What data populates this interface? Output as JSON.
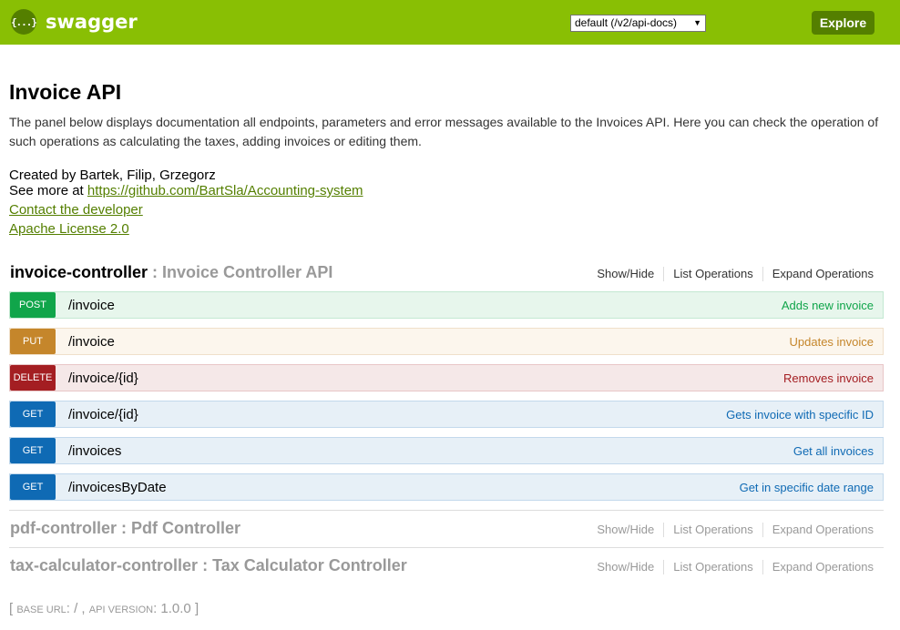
{
  "header": {
    "logo_glyph": "{...}",
    "logo_text": "swagger",
    "spec_select": "default (/v2/api-docs)",
    "explore_label": "Explore",
    "bg_color": "#89bf04"
  },
  "info": {
    "title": "Invoice API",
    "description": "The panel below displays documentation all endpoints, parameters and error messages available to the Invoices API. Here you can check the operation of such operations as calculating the taxes, adding invoices or editing them.",
    "created_by": "Created by Bartek, Filip, Grzegorz",
    "see_more_prefix": "See more at ",
    "see_more_link": "https://github.com/BartSla/Accounting-system",
    "contact_link": "Contact the developer",
    "license_link": "Apache License 2.0"
  },
  "resources": [
    {
      "name": "invoice-controller",
      "separator": " : ",
      "description": "Invoice Controller API",
      "show_hide": "Show/Hide",
      "list_ops": "List Operations",
      "expand_ops": "Expand Operations",
      "operations": [
        {
          "method": "POST",
          "path": "/invoice",
          "summary": "Adds new invoice"
        },
        {
          "method": "PUT",
          "path": "/invoice",
          "summary": "Updates invoice"
        },
        {
          "method": "DELETE",
          "path": "/invoice/{id}",
          "summary": "Removes invoice"
        },
        {
          "method": "GET",
          "path": "/invoice/{id}",
          "summary": "Gets invoice with specific ID"
        },
        {
          "method": "GET",
          "path": "/invoices",
          "summary": "Get all invoices"
        },
        {
          "method": "GET",
          "path": "/invoicesByDate",
          "summary": "Get in specific date range"
        }
      ]
    },
    {
      "name": "pdf-controller",
      "separator": " : ",
      "description": "Pdf Controller",
      "show_hide": "Show/Hide",
      "list_ops": "List Operations",
      "expand_ops": "Expand Operations"
    },
    {
      "name": "tax-calculator-controller",
      "separator": " : ",
      "description": "Tax Calculator Controller",
      "show_hide": "Show/Hide",
      "list_ops": "List Operations",
      "expand_ops": "Expand Operations"
    }
  ],
  "footer": {
    "open": "[ ",
    "base_url_label": "Base url",
    "base_url_value": ": / , ",
    "api_version_label": "Api version",
    "api_version_value": ": 1.0.0 ]"
  }
}
